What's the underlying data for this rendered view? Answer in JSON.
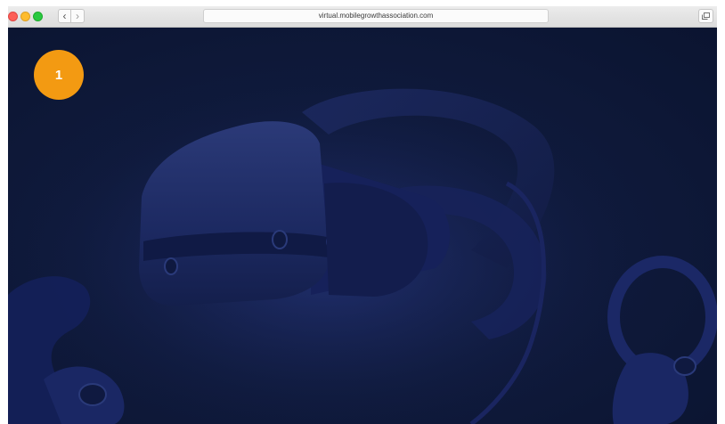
{
  "browser": {
    "url": "virtual.mobilegrowthassociation.com",
    "back_glyph": "‹",
    "forward_glyph": "›"
  },
  "slide": {
    "badge_number": "1"
  },
  "colors": {
    "accent_badge": "#f39a12",
    "page_background": "#0d1533"
  },
  "icons": [
    "close-light",
    "minimize-light",
    "zoom-light",
    "back-icon",
    "forward-icon",
    "tabs-icon"
  ]
}
